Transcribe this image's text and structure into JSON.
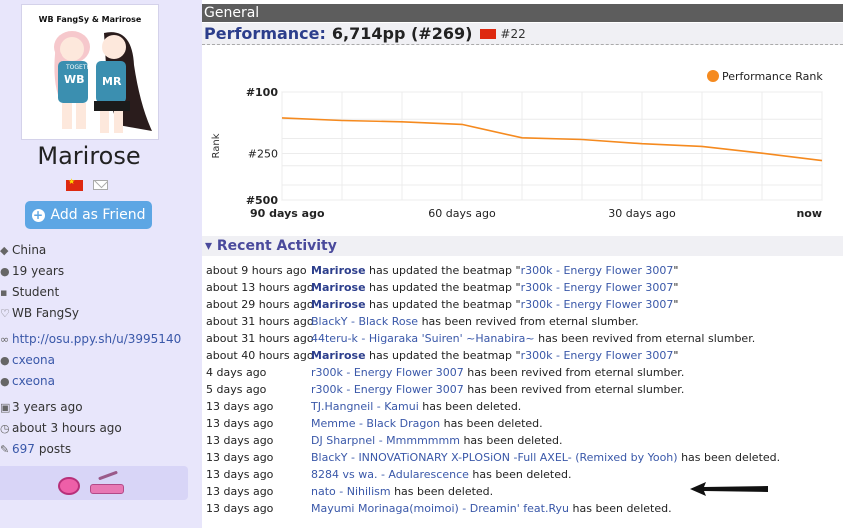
{
  "profile": {
    "avatar_caption": "WB FangSy & Marirose",
    "avatar_shirt_left": "WB",
    "avatar_shirt_right": "MR",
    "avatar_shirt_text": "TOGETHER",
    "username": "Marirose",
    "add_friend": "Add as Friend",
    "country": "China",
    "age": "19 years",
    "occupation": "Student",
    "interests": "WB FangSy",
    "website": "http://osu.ppy.sh/u/3995140",
    "skype": "cxeona",
    "twitter": "cxeona",
    "joined": "3 years ago",
    "last_active": "about 3 hours ago",
    "posts_count": "697",
    "posts_label": "posts"
  },
  "main": {
    "section_title": "General",
    "performance_label": "Performance:",
    "performance_value": "6,714pp (#269)",
    "country_rank": "#22"
  },
  "chart_data": {
    "type": "line",
    "series": [
      {
        "name": "Performance Rank",
        "color": "#f58a1f",
        "x": [
          90,
          80,
          70,
          60,
          50,
          40,
          30,
          20,
          10,
          0
        ],
        "values": [
          147,
          153,
          156,
          162,
          198,
          203,
          216,
          225,
          249,
          278
        ]
      }
    ],
    "x_tick_labels": [
      "90 days ago",
      "60 days ago",
      "30 days ago",
      "now"
    ],
    "y_tick_labels": [
      "#100",
      "#250",
      "#500"
    ],
    "ylabel": "Rank",
    "y_range": [
      100,
      500
    ],
    "y_scale": "reversed",
    "legend_position": "top-right",
    "grid": true
  },
  "activity": {
    "title": "Recent Activity",
    "rows": [
      {
        "time": "about 9 hours ago",
        "user": "Marirose",
        "mid": " has updated the beatmap \"",
        "link": "r300k - Energy Flower 3007",
        "tail": "\""
      },
      {
        "time": "about 13 hours ago",
        "user": "Marirose",
        "mid": " has updated the beatmap \"",
        "link": "r300k - Energy Flower 3007",
        "tail": "\""
      },
      {
        "time": "about 29 hours ago",
        "user": "Marirose",
        "mid": " has updated the beatmap \"",
        "link": "r300k - Energy Flower 3007",
        "tail": "\""
      },
      {
        "time": "about 31 hours ago",
        "user": "",
        "mid": "",
        "link": "BlackY - Black Rose",
        "tail": " has been revived from eternal slumber."
      },
      {
        "time": "about 31 hours ago",
        "user": "",
        "mid": "",
        "link": "44teru-k - Higaraka 'Suiren' ~Hanabira~",
        "tail": " has been revived from eternal slumber."
      },
      {
        "time": "about 40 hours ago",
        "user": "Marirose",
        "mid": " has updated the beatmap \"",
        "link": "r300k - Energy Flower 3007",
        "tail": "\""
      },
      {
        "time": "4 days ago",
        "user": "",
        "mid": "",
        "link": "r300k - Energy Flower 3007",
        "tail": " has been revived from eternal slumber."
      },
      {
        "time": "5 days ago",
        "user": "",
        "mid": "",
        "link": "r300k - Energy Flower 3007",
        "tail": " has been revived from eternal slumber."
      },
      {
        "time": "13 days ago",
        "user": "",
        "mid": "",
        "link": "TJ.Hangneil - Kamui",
        "tail": " has been deleted."
      },
      {
        "time": "13 days ago",
        "user": "",
        "mid": "",
        "link": "Memme - Black Dragon",
        "tail": " has been deleted."
      },
      {
        "time": "13 days ago",
        "user": "",
        "mid": "",
        "link": "DJ Sharpnel - Mmmmmmm",
        "tail": " has been deleted."
      },
      {
        "time": "13 days ago",
        "user": "",
        "mid": "",
        "link": "BlackY - INNOVATiONARY X-PLOSiON -Full AXEL- (Remixed by Yooh)",
        "tail": " has been deleted."
      },
      {
        "time": "13 days ago",
        "user": "",
        "mid": "",
        "link": "8284 vs wa. - Adularescence",
        "tail": " has been deleted."
      },
      {
        "time": "13 days ago",
        "user": "",
        "mid": "",
        "link": "nato - Nihilism",
        "tail": " has been deleted."
      },
      {
        "time": "13 days ago",
        "user": "",
        "mid": "",
        "link": "Mayumi Morinaga(moimoi) - Dreamin' feat.Ryu",
        "tail": " has been deleted."
      }
    ]
  }
}
